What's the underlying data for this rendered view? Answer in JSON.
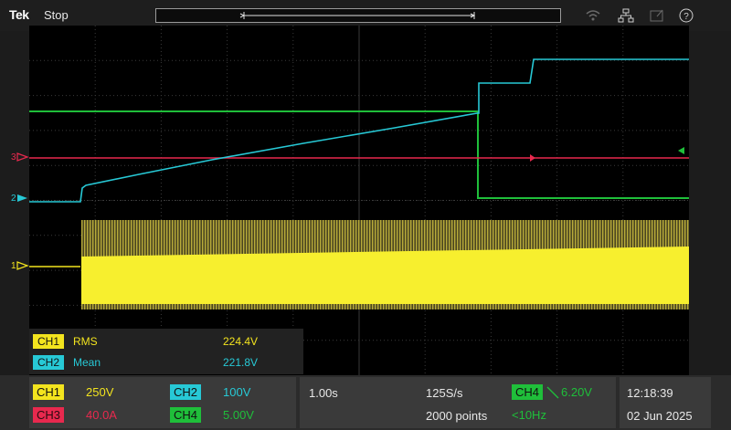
{
  "app": {
    "logo": "Tek",
    "run_state": "Stop"
  },
  "colors": {
    "ch1": "#f3e41e",
    "ch2": "#27c9d6",
    "ch3": "#e8294e",
    "ch4": "#1fbf3a",
    "grid": "#3a3a3a"
  },
  "channel_markers": {
    "ch1": "1",
    "ch2": "2",
    "ch3": "3"
  },
  "measurements": [
    {
      "channel": "CH1",
      "type": "RMS",
      "value": "224.4V"
    },
    {
      "channel": "CH2",
      "type": "Mean",
      "value": "221.8V"
    }
  ],
  "channels": {
    "ch1": {
      "label": "CH1",
      "scale": "250V"
    },
    "ch2": {
      "label": "CH2",
      "scale": "100V"
    },
    "ch3": {
      "label": "CH3",
      "scale": "40.0A"
    },
    "ch4": {
      "label": "CH4",
      "scale": "5.00V"
    }
  },
  "horizontal": {
    "scale": "1.00s",
    "sample_rate": "125S/s",
    "record_length": "2000 points"
  },
  "trigger": {
    "source": "CH4",
    "level": "6.20V",
    "frequency": "<10Hz"
  },
  "datetime": {
    "time": "12:18:39",
    "date": "02 Jun 2025"
  },
  "icons": [
    "wifi-icon",
    "network-icon",
    "export-icon",
    "help-icon"
  ]
}
